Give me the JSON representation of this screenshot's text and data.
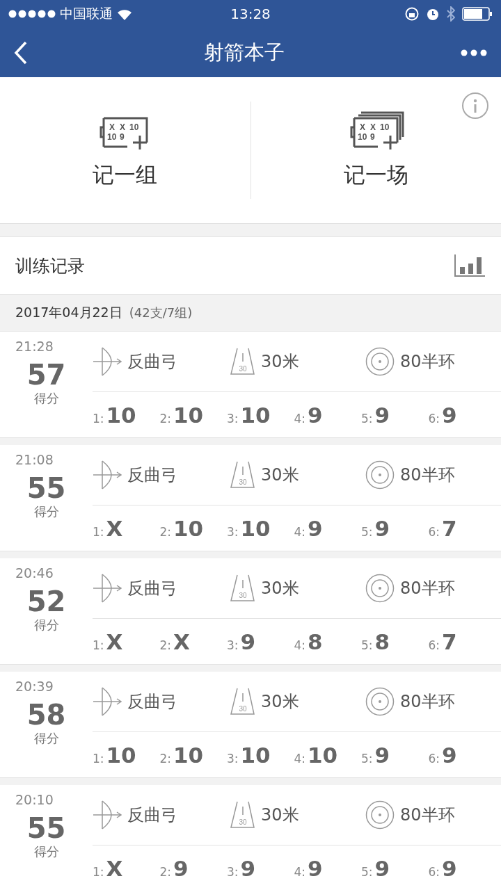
{
  "status_bar": {
    "carrier": "中国联通",
    "time": "13:28"
  },
  "nav": {
    "title": "射箭本子"
  },
  "actions": [
    {
      "kind": "single",
      "label": "记一组",
      "marks": [
        "X",
        "X",
        "10",
        "10",
        "9"
      ]
    },
    {
      "kind": "multi",
      "label": "记一场",
      "marks": [
        "X",
        "X",
        "10",
        "10",
        "9"
      ]
    }
  ],
  "section": {
    "title": "训练记录"
  },
  "date_group": {
    "date": "2017年04月22日",
    "summary": "(42支/7组)"
  },
  "records": [
    {
      "time": "21:28",
      "score": "57",
      "score_label": "得分",
      "bow": "反曲弓",
      "distance": "30米",
      "distance_mark": "30",
      "target": "80半环",
      "arrows": [
        {
          "index": "1:",
          "value": "10"
        },
        {
          "index": "2:",
          "value": "10"
        },
        {
          "index": "3:",
          "value": "10"
        },
        {
          "index": "4:",
          "value": "9"
        },
        {
          "index": "5:",
          "value": "9"
        },
        {
          "index": "6:",
          "value": "9"
        }
      ]
    },
    {
      "time": "21:08",
      "score": "55",
      "score_label": "得分",
      "bow": "反曲弓",
      "distance": "30米",
      "distance_mark": "30",
      "target": "80半环",
      "arrows": [
        {
          "index": "1:",
          "value": "X"
        },
        {
          "index": "2:",
          "value": "10"
        },
        {
          "index": "3:",
          "value": "10"
        },
        {
          "index": "4:",
          "value": "9"
        },
        {
          "index": "5:",
          "value": "9"
        },
        {
          "index": "6:",
          "value": "7"
        }
      ]
    },
    {
      "time": "20:46",
      "score": "52",
      "score_label": "得分",
      "bow": "反曲弓",
      "distance": "30米",
      "distance_mark": "30",
      "target": "80半环",
      "arrows": [
        {
          "index": "1:",
          "value": "X"
        },
        {
          "index": "2:",
          "value": "X"
        },
        {
          "index": "3:",
          "value": "9"
        },
        {
          "index": "4:",
          "value": "8"
        },
        {
          "index": "5:",
          "value": "8"
        },
        {
          "index": "6:",
          "value": "7"
        }
      ]
    },
    {
      "time": "20:39",
      "score": "58",
      "score_label": "得分",
      "bow": "反曲弓",
      "distance": "30米",
      "distance_mark": "30",
      "target": "80半环",
      "arrows": [
        {
          "index": "1:",
          "value": "10"
        },
        {
          "index": "2:",
          "value": "10"
        },
        {
          "index": "3:",
          "value": "10"
        },
        {
          "index": "4:",
          "value": "10"
        },
        {
          "index": "5:",
          "value": "9"
        },
        {
          "index": "6:",
          "value": "9"
        }
      ]
    },
    {
      "time": "20:10",
      "score": "55",
      "score_label": "得分",
      "bow": "反曲弓",
      "distance": "30米",
      "distance_mark": "30",
      "target": "80半环",
      "arrows": [
        {
          "index": "1:",
          "value": "X"
        },
        {
          "index": "2:",
          "value": "9"
        },
        {
          "index": "3:",
          "value": "9"
        },
        {
          "index": "4:",
          "value": "9"
        },
        {
          "index": "5:",
          "value": "9"
        },
        {
          "index": "6:",
          "value": "9"
        }
      ]
    }
  ]
}
